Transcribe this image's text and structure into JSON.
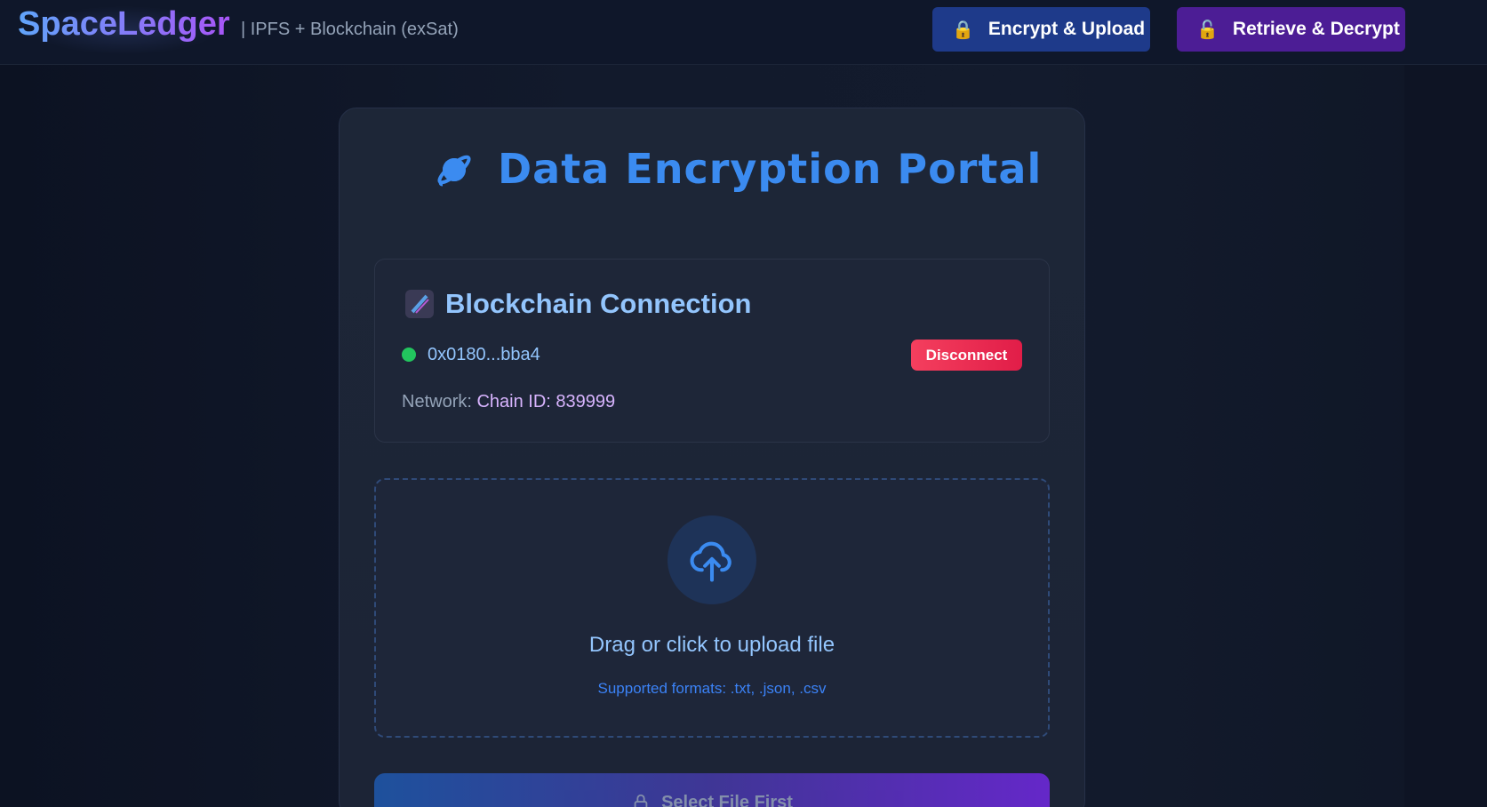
{
  "header": {
    "brand": "SpaceLedger",
    "tagline": "| IPFS + Blockchain (exSat)",
    "nav": [
      {
        "label": "Encrypt & Upload",
        "icon": "lock-icon",
        "color": "#1e3a8a"
      },
      {
        "label": "Retrieve & Decrypt",
        "icon": "unlock-icon",
        "color": "#4c1d95"
      }
    ]
  },
  "main": {
    "title": "Data Encryption Portal",
    "title_icon": "planet-icon",
    "connection": {
      "title": "Blockchain Connection",
      "icon": "satellite-icon",
      "status_color": "#22c55e",
      "address": "0x0180...bba4",
      "disconnect_label": "Disconnect",
      "network_label": "Network:",
      "network_value": "Chain ID: 839999"
    },
    "upload": {
      "icon": "cloud-upload-icon",
      "title": "Drag or click to upload file",
      "formats": "Supported formats: .txt, .json, .csv"
    },
    "submit_label": "Select File First"
  },
  "colors": {
    "accent": "#3b8bf0",
    "danger": "#e11d48",
    "purple": "#a855f7"
  }
}
